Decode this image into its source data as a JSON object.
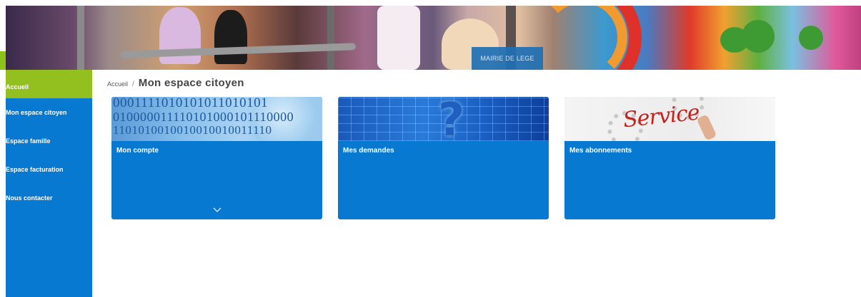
{
  "banner": {
    "tag": "MAIRIE DE LEGE"
  },
  "sidebar": {
    "items": [
      {
        "label": "Accueil",
        "active": true
      },
      {
        "label": "Mon espace citoyen",
        "active": false
      },
      {
        "label": "Espace famille",
        "active": false
      },
      {
        "label": "Espace facturation",
        "active": false
      },
      {
        "label": "Nous contacter",
        "active": false
      }
    ]
  },
  "breadcrumb": {
    "home": "Accueil",
    "separator": "/",
    "current": "Mon espace citoyen"
  },
  "cards": [
    {
      "title": "Mon compte",
      "image": "binary-code-face",
      "icon": "chevron-down-icon"
    },
    {
      "title": "Mes demandes",
      "image": "blue-grid-question-mark"
    },
    {
      "title": "Mes abonnements",
      "image": "service-handwritten",
      "image_text": "Service"
    }
  ],
  "colors": {
    "primary_blue": "#0879d1",
    "active_green": "#93c01f",
    "text_dark": "#444444"
  }
}
